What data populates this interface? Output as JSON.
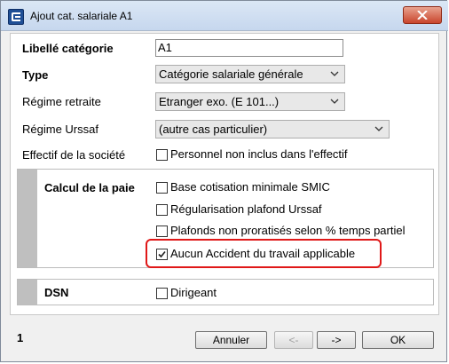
{
  "window": {
    "title": "Ajout cat. salariale A1"
  },
  "form": {
    "libelle_label": "Libellé catégorie",
    "libelle_value": "A1",
    "type_label": "Type",
    "type_value": "Catégorie salariale générale",
    "regime_retraite_label": "Régime retraite",
    "regime_retraite_value": "Etranger exo. (E 101...)",
    "regime_urssaf_label": "Régime Urssaf",
    "regime_urssaf_value": "(autre cas particulier)",
    "effectif_label": "Effectif de la société",
    "effectif_checkbox": {
      "label": "Personnel non inclus dans l'effectif",
      "checked": false
    }
  },
  "calcul_paie": {
    "title": "Calcul de la paie",
    "options": [
      {
        "label": "Base cotisation minimale SMIC",
        "checked": false
      },
      {
        "label": "Régularisation plafond Urssaf",
        "checked": false
      },
      {
        "label": "Plafonds non proratisés selon % temps partiel",
        "checked": false
      },
      {
        "label": "Aucun Accident du travail applicable",
        "checked": true
      }
    ]
  },
  "dsn": {
    "title": "DSN",
    "dirigeant": {
      "label": "Dirigeant",
      "checked": false
    }
  },
  "footer": {
    "page_number": "1",
    "cancel_label": "Annuler",
    "prev_label": "<-",
    "next_label": "->",
    "ok_label": "OK"
  },
  "colors": {
    "highlight": "#e01818",
    "group_bar": "#bfbfbf"
  }
}
